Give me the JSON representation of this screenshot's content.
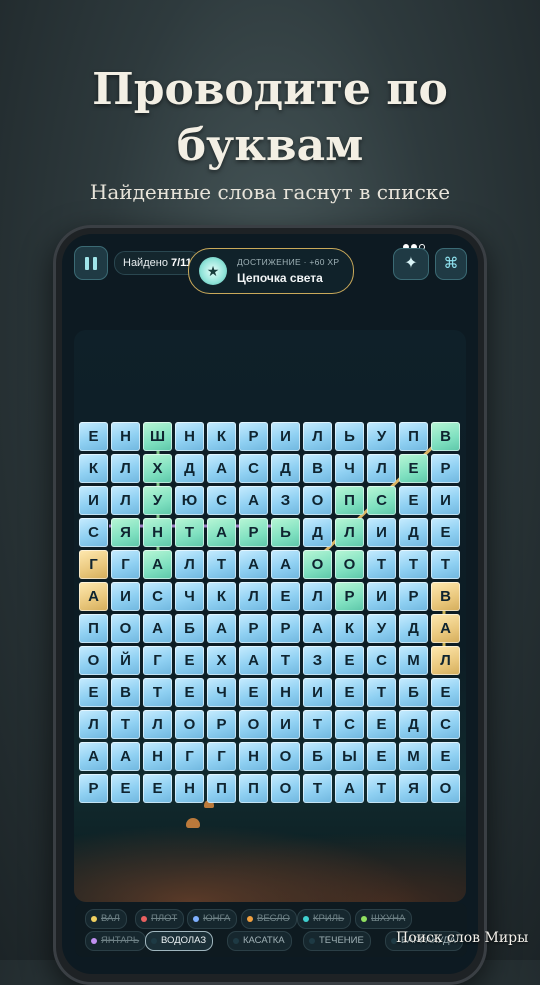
{
  "hero": {
    "title_line1": "Проводите по",
    "title_line2": "буквам",
    "subtitle": "Найденные слова гаснут в списке"
  },
  "topbar": {
    "found_label": "Найдено",
    "found_count": "7/11",
    "achievement_label": "ДОСТИЖЕНИЕ · +60 XP",
    "achievement_title": "Цепочка света",
    "achievement_icon": "star-icon",
    "hint_icon": "sparkle-icon",
    "map_icon": "map-icon",
    "pause_icon": "pause-icon"
  },
  "grid": [
    [
      "Е",
      "Н",
      "Ш",
      "Н",
      "К",
      "Р",
      "И",
      "Л",
      "Ь",
      "У",
      "П",
      "В"
    ],
    [
      "К",
      "Л",
      "Х",
      "Д",
      "А",
      "С",
      "Д",
      "В",
      "Ч",
      "Л",
      "Е",
      "Р"
    ],
    [
      "И",
      "Л",
      "У",
      "Ю",
      "С",
      "А",
      "З",
      "О",
      "П",
      "С",
      "Е",
      "И"
    ],
    [
      "С",
      "Я",
      "Н",
      "Т",
      "А",
      "Р",
      "Ь",
      "Д",
      "Л",
      "И",
      "Д",
      "Е"
    ],
    [
      "Г",
      "Г",
      "А",
      "Л",
      "Т",
      "А",
      "А",
      "О",
      "О",
      "Т",
      "Т",
      "Т"
    ],
    [
      "А",
      "И",
      "С",
      "Ч",
      "К",
      "Л",
      "Е",
      "Л",
      "Р",
      "И",
      "Р",
      "В"
    ],
    [
      "П",
      "О",
      "А",
      "Б",
      "А",
      "Р",
      "Р",
      "А",
      "К",
      "У",
      "Д",
      "А"
    ],
    [
      "О",
      "Й",
      "Г",
      "Е",
      "Х",
      "А",
      "Т",
      "З",
      "Е",
      "С",
      "М",
      "Л"
    ],
    [
      "Е",
      "В",
      "Т",
      "Е",
      "Ч",
      "Е",
      "Н",
      "И",
      "Е",
      "Т",
      "Б",
      "Е"
    ],
    [
      "Л",
      "Т",
      "Л",
      "О",
      "Р",
      "О",
      "И",
      "Т",
      "С",
      "Е",
      "Д",
      "С"
    ],
    [
      "А",
      "А",
      "Н",
      "Г",
      "Г",
      "Н",
      "О",
      "Б",
      "Ы",
      "Е",
      "М",
      "Е"
    ],
    [
      "Р",
      "Е",
      "Е",
      "Н",
      "П",
      "П",
      "О",
      "Т",
      "А",
      "Т",
      "Я",
      "О"
    ]
  ],
  "words": [
    {
      "label": "ВАЛ",
      "done": true,
      "color": "#f0d060"
    },
    {
      "label": "ПЛОТ",
      "done": true,
      "color": "#e86060"
    },
    {
      "label": "ЮНГА",
      "done": true,
      "color": "#7fb0ff"
    },
    {
      "label": "ВЕСЛО",
      "done": true,
      "color": "#f0a040"
    },
    {
      "label": "КРИЛЬ",
      "done": true,
      "color": "#40d0d0"
    },
    {
      "label": "ШХУНА",
      "done": true,
      "color": "#90e060"
    },
    {
      "label": "ЯНТАРЬ",
      "done": true,
      "color": "#c090f0"
    },
    {
      "label": "ВОДОЛАЗ",
      "done": false,
      "active": true,
      "color": "#1e3a44"
    },
    {
      "label": "КАСАТКА",
      "done": false,
      "color": "#1e3a44"
    },
    {
      "label": "ТЕЧЕНИЕ",
      "done": false,
      "color": "#1e3a44"
    },
    {
      "label": "БАРРАКУДА",
      "done": false,
      "color": "#1e3a44"
    }
  ],
  "watermark": "Поиск слов Миры"
}
